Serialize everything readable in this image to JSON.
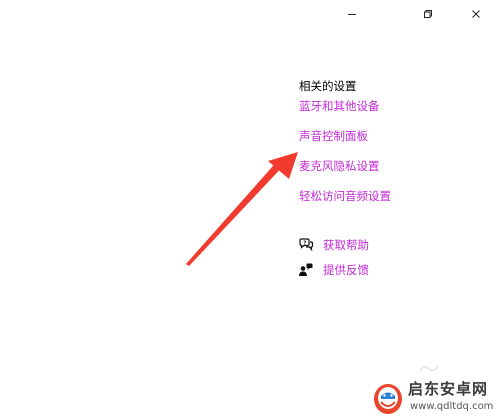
{
  "window_controls": {
    "minimize": "minimize",
    "restore": "restore",
    "close": "close"
  },
  "related_settings": {
    "title": "相关的设置",
    "links": [
      "蓝牙和其他设备",
      "声音控制面板",
      "麦克风隐私设置",
      "轻松访问音频设置"
    ]
  },
  "help": {
    "get_help": "获取帮助",
    "feedback": "提供反馈"
  },
  "annotation": {
    "arrow_color": "#f23a2e"
  },
  "watermark": {
    "name": "启东安卓网",
    "url": "www.qdltdq.com",
    "logo_color": "#e8452c"
  },
  "colors": {
    "link": "#c42ad6",
    "text": "#000000",
    "background": "#ffffff"
  }
}
